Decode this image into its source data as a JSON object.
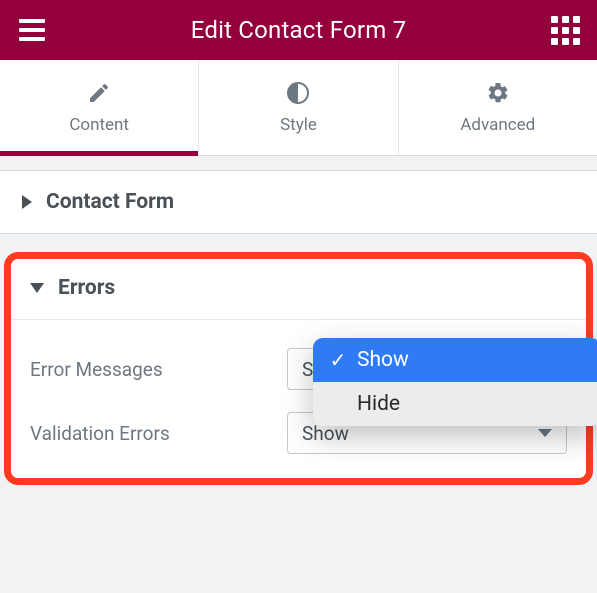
{
  "header": {
    "title": "Edit Contact Form 7"
  },
  "tabs": [
    {
      "label": "Content"
    },
    {
      "label": "Style"
    },
    {
      "label": "Advanced"
    }
  ],
  "sections": {
    "contact_form": {
      "title": "Contact Form"
    },
    "errors": {
      "title": "Errors",
      "error_messages": {
        "label": "Error Messages",
        "value": "Show",
        "options": [
          "Show",
          "Hide"
        ]
      },
      "validation_errors": {
        "label": "Validation Errors",
        "value": "Show"
      }
    }
  }
}
